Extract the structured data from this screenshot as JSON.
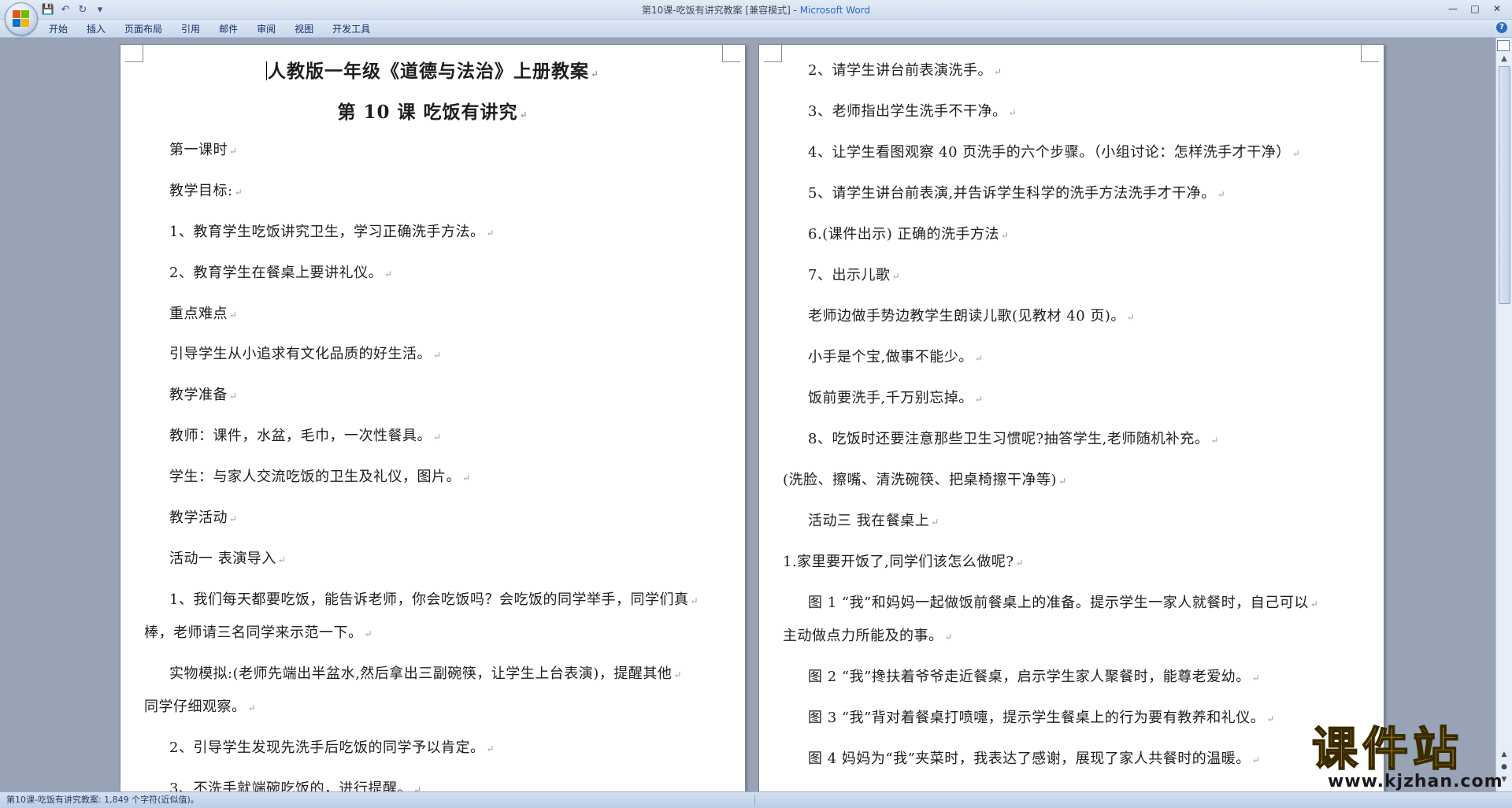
{
  "window": {
    "title_doc": "第10课-吃饭有讲究教案 [兼容模式] - ",
    "title_app": "Microsoft Word"
  },
  "qat": {
    "save_icon": "💾",
    "undo_icon": "↶",
    "redo_icon": "↻",
    "customize_icon": "▾"
  },
  "ribbon": {
    "tabs": [
      "开始",
      "插入",
      "页面布局",
      "引用",
      "邮件",
      "审阅",
      "视图",
      "开发工具"
    ],
    "help": "?"
  },
  "left_page": {
    "lines": [
      {
        "text": "人教版一年级《道德与法治》上册教案"
      },
      {
        "text": "第 10 课  吃饭有讲究"
      },
      {
        "text": "第一课时"
      },
      {
        "text": "教学目标:"
      },
      {
        "text": "1、教育学生吃饭讲究卫生，学习正确洗手方法。"
      },
      {
        "text": "2、教育学生在餐桌上要讲礼仪。"
      },
      {
        "text": "重点难点"
      },
      {
        "text": "引导学生从小追求有文化品质的好生活。"
      },
      {
        "text": "教学准备"
      },
      {
        "text": "教师：课件，水盆，毛巾，一次性餐具。"
      },
      {
        "text": "学生：与家人交流吃饭的卫生及礼仪，图片。"
      },
      {
        "text": "教学活动"
      },
      {
        "text": "活动一   表演导入"
      },
      {
        "text": "1、我们每天都要吃饭，能告诉老师，你会吃饭吗？会吃饭的同学举手，同学们真"
      },
      {
        "text": "棒，老师请三名同学来示范一下。"
      },
      {
        "text": "实物模拟:(老师先端出半盆水,然后拿出三副碗筷，让学生上台表演)，提醒其他"
      },
      {
        "text": "同学仔细观察。"
      },
      {
        "text": "2、引导学生发现先洗手后吃饭的同学予以肯定。"
      },
      {
        "text": "3、不洗手就端碗吃饭的，进行提醒。"
      }
    ]
  },
  "right_page": {
    "lines": [
      {
        "text": "2、请学生讲台前表演洗手。"
      },
      {
        "text": "3、老师指出学生洗手不干净。"
      },
      {
        "text": "4、让学生看图观察 40 页洗手的六个步骤。（小组讨论：怎样洗手才干净）"
      },
      {
        "text": "5、请学生讲台前表演,并告诉学生科学的洗手方法洗手才干净。"
      },
      {
        "text": "6.(课件出示) 正确的洗手方法"
      },
      {
        "text": "7、出示儿歌"
      },
      {
        "text": "老师边做手势边教学生朗读儿歌(见教材 40 页)。"
      },
      {
        "text": "小手是个宝,做事不能少。"
      },
      {
        "text": "饭前要洗手,千万别忘掉。"
      },
      {
        "text": "8、吃饭时还要注意那些卫生习惯呢?抽答学生,老师随机补充。"
      },
      {
        "text": "(洗脸、擦嘴、清洗碗筷、把桌椅擦干净等)"
      },
      {
        "text": "活动三   我在餐桌上"
      },
      {
        "text": "1.家里要开饭了,同学们该怎么做呢?"
      },
      {
        "text": "图 1 “我”和妈妈一起做饭前餐桌上的准备。提示学生一家人就餐时，自己可以"
      },
      {
        "text": "主动做点力所能及的事。"
      },
      {
        "text": "图 2 “我”搀扶着爷爷走近餐桌，启示学生家人聚餐时，能尊老爱幼。"
      },
      {
        "text": "图 3 “我”背对着餐桌打喷嚏，提示学生餐桌上的行为要有教养和礼仪。"
      },
      {
        "text": "图 4 妈妈为“我”夹菜时，我表达了感谢，展现了家人共餐时的温暖。"
      }
    ]
  },
  "paragraph_mark": "↵",
  "status_bar": {
    "text": "第10课-吃饭有讲究教案: 1,849 个字符(近似值)。"
  },
  "watermark": {
    "main": "课件站",
    "sub": "www.kjzhan.com"
  }
}
